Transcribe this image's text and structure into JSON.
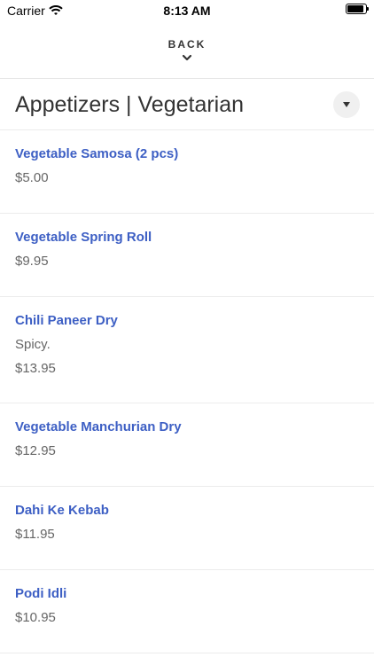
{
  "status": {
    "carrier": "Carrier",
    "time": "8:13 AM"
  },
  "nav": {
    "back_label": "BACK"
  },
  "category": {
    "title": "Appetizers | Vegetarian"
  },
  "items": [
    {
      "name": "Vegetable Samosa (2 pcs)",
      "price": "$5.00"
    },
    {
      "name": "Vegetable Spring Roll",
      "price": "$9.95"
    },
    {
      "name": "Chili Paneer Dry",
      "description": "Spicy.",
      "price": "$13.95"
    },
    {
      "name": "Vegetable Manchurian Dry",
      "price": "$12.95"
    },
    {
      "name": "Dahi Ke Kebab",
      "price": "$11.95"
    },
    {
      "name": "Podi Idli",
      "price": "$10.95"
    }
  ],
  "colors": {
    "item_name": "#3d5fc4",
    "price": "#666666",
    "divider": "#ececec"
  },
  "icons": {
    "wifi": "wifi-icon",
    "battery": "battery-icon",
    "chevron": "chevron-down-icon",
    "dropdown": "dropdown-arrow-icon"
  }
}
